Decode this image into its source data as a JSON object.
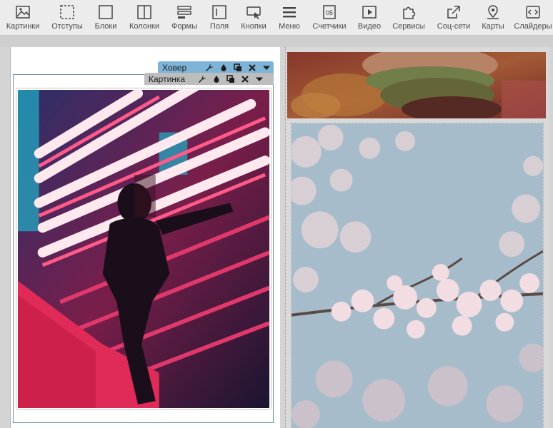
{
  "toolbar": {
    "items": [
      {
        "label": "Картинки",
        "icon": "image-icon"
      },
      {
        "label": "Отступы",
        "icon": "spacing-icon"
      },
      {
        "label": "Блоки",
        "icon": "block-icon"
      },
      {
        "label": "Колонки",
        "icon": "columns-icon"
      },
      {
        "label": "Формы",
        "icon": "form-icon"
      },
      {
        "label": "Поля",
        "icon": "field-icon"
      },
      {
        "label": "Кнопки",
        "icon": "button-icon"
      },
      {
        "label": "Меню",
        "icon": "menu-icon"
      },
      {
        "label": "Счетчики",
        "icon": "counter-icon"
      },
      {
        "label": "Видео",
        "icon": "video-icon"
      },
      {
        "label": "Сервисы",
        "icon": "puzzle-icon"
      },
      {
        "label": "Соц-сети",
        "icon": "share-icon"
      },
      {
        "label": "Карты",
        "icon": "map-pin-icon"
      },
      {
        "label": "Слайдеры",
        "icon": "slider-icon"
      }
    ]
  },
  "editor": {
    "hover_tag": {
      "label": "Ховер"
    },
    "picture_tag": {
      "label": "Картинка"
    },
    "tag_actions": [
      "wrench-icon",
      "drop-icon",
      "copy-icon",
      "delete-icon",
      "dropdown-icon"
    ]
  },
  "colors": {
    "toolbar_bg": "#ececec",
    "hover_tag_bg": "#7db4d8",
    "picture_tag_bg": "#bdbdbd",
    "frame_border": "#6e8fb0"
  }
}
